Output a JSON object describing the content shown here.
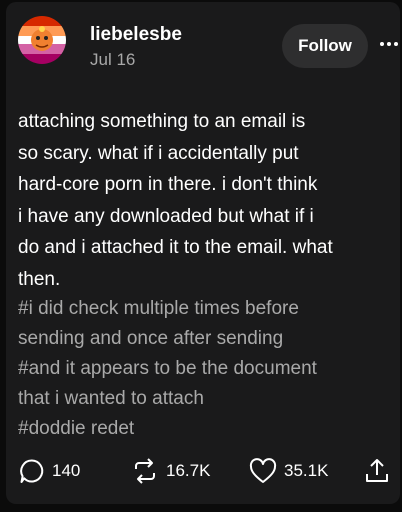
{
  "post": {
    "username": "liebelesbe",
    "date": "Jul 16",
    "follow_label": "Follow",
    "body_lines": [
      "attaching something to an email is",
      "so scary. what if i accidentally put",
      "hard-core porn in there. i don't think",
      "i have any downloaded but what if i",
      "do and i attached it to the email. what",
      "then."
    ],
    "tag_lines": [
      "#i did check multiple times before",
      "sending and once after sending",
      "#and it appears to be the document",
      "that i wanted to attach",
      "#doddie redet"
    ]
  },
  "actions": {
    "replies": "140",
    "reblogs": "16.7K",
    "likes": "35.1K"
  },
  "icons": {
    "avatar": "avatar-lesbian-flag-cartoon",
    "more": "more-dots-icon",
    "reply": "speech-bubble-icon",
    "reblog": "repost-arrows-icon",
    "like": "heart-icon",
    "share": "share-upload-icon"
  },
  "colors": {
    "background": "#0b0b0b",
    "card": "#1a1a1b",
    "text": "#ffffff",
    "muted": "#a8a8a8",
    "follow_button": "#2e2e2f"
  }
}
